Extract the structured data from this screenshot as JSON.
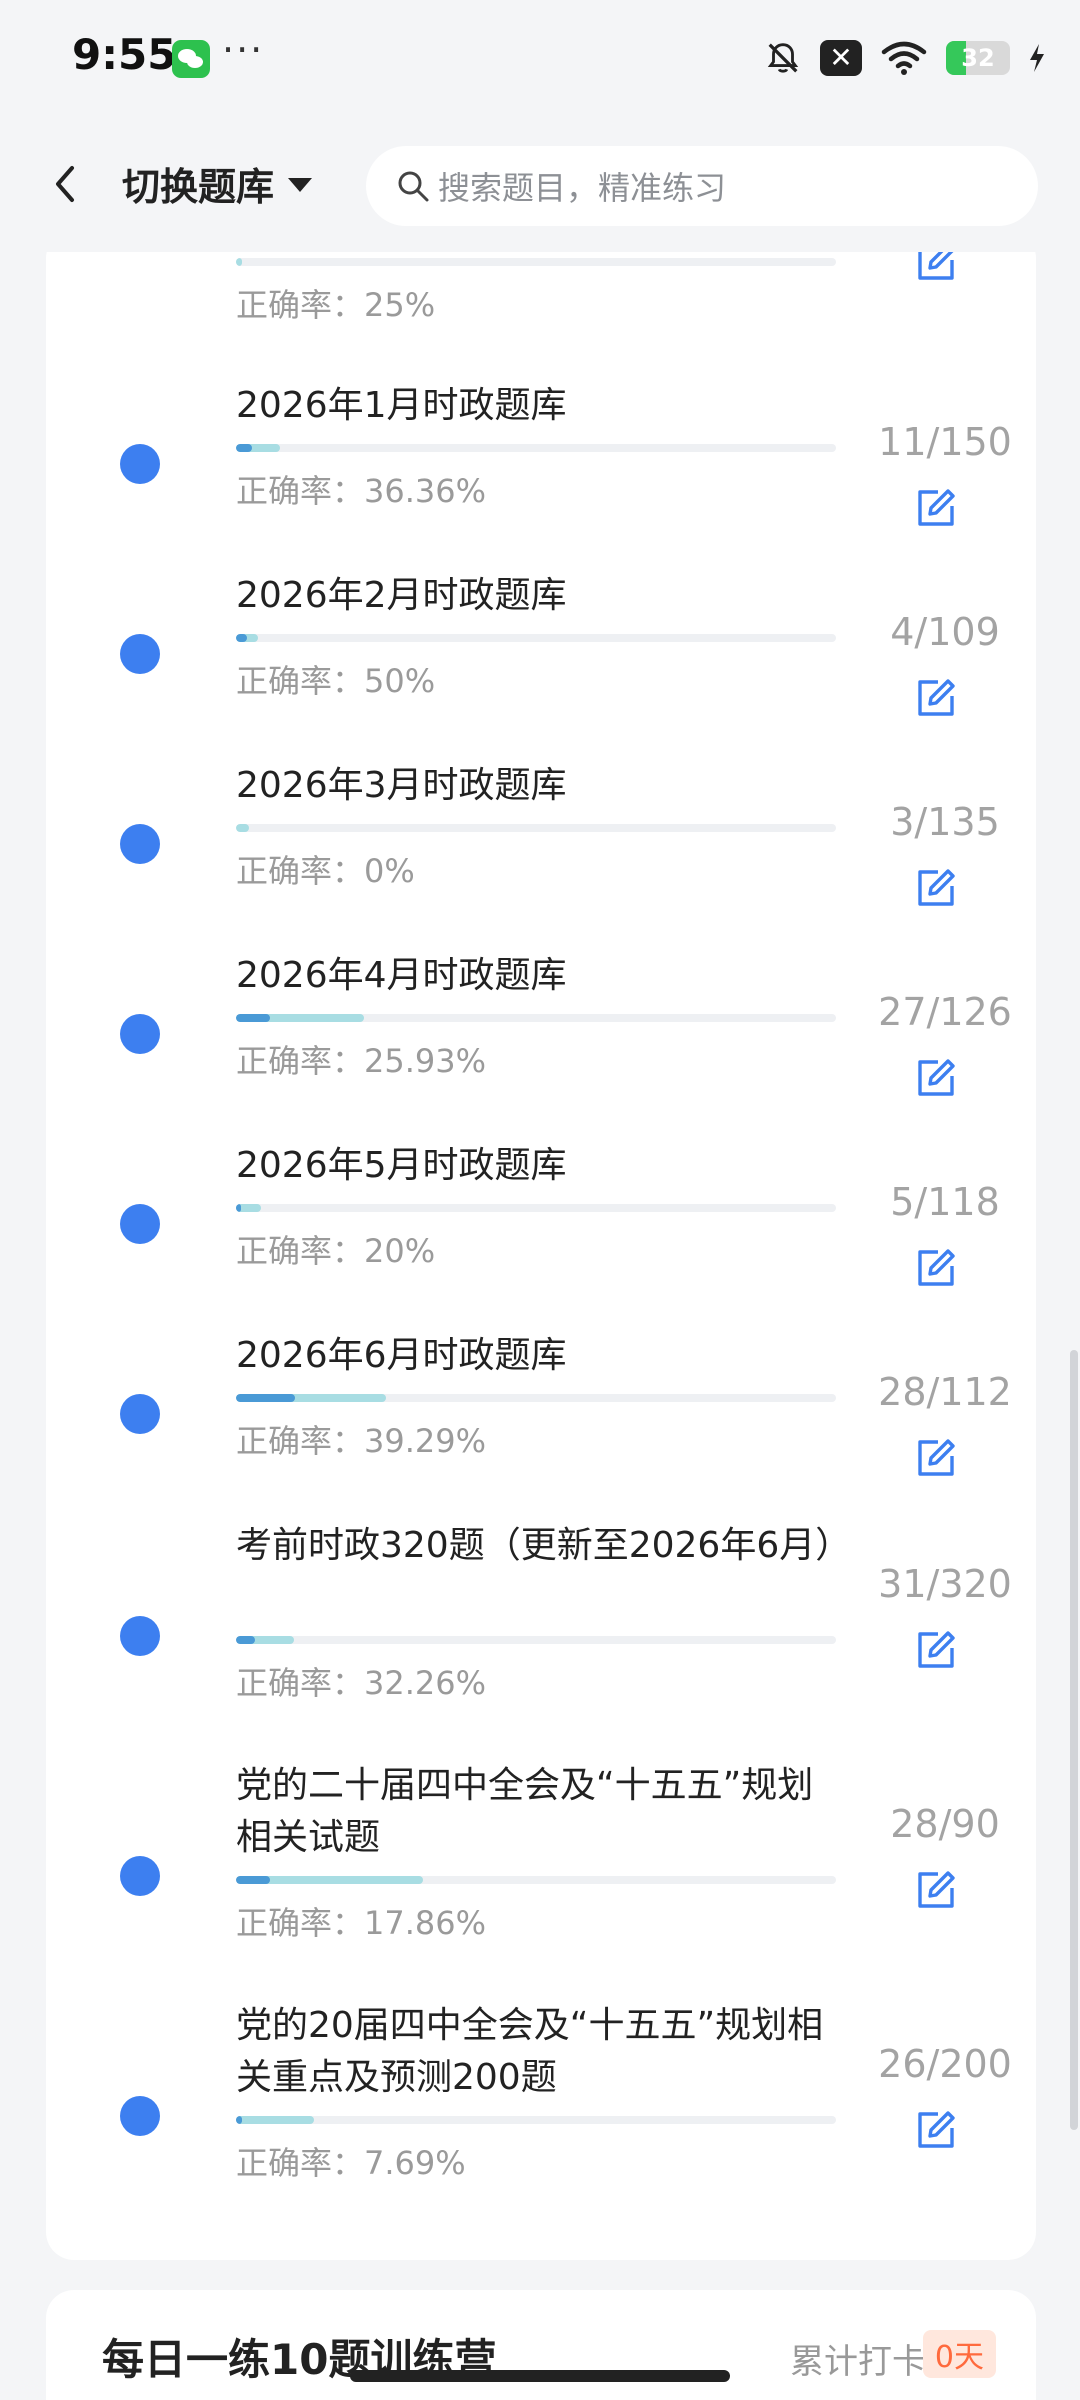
{
  "status": {
    "time": "9:55",
    "dots": "···",
    "battery": "32"
  },
  "nav": {
    "switch_label": "切换题库",
    "search_placeholder": "搜索题目，精准练习"
  },
  "partial_item": {
    "accuracy": "正确率：25%",
    "progress": 0.01
  },
  "items": [
    {
      "title": "2026年1月时政题库",
      "accuracy": "正确率：36.36%",
      "count": "11/150",
      "progress_done": 0.073,
      "progress_correct": 0.027
    },
    {
      "title": "2026年2月时政题库",
      "accuracy": "正确率：50%",
      "count": "4/109",
      "progress_done": 0.037,
      "progress_correct": 0.018
    },
    {
      "title": "2026年3月时政题库",
      "accuracy": "正确率：0%",
      "count": "3/135",
      "progress_done": 0.022,
      "progress_correct": 0.0
    },
    {
      "title": "2026年4月时政题库",
      "accuracy": "正确率：25.93%",
      "count": "27/126",
      "progress_done": 0.214,
      "progress_correct": 0.056
    },
    {
      "title": "2026年5月时政题库",
      "accuracy": "正确率：20%",
      "count": "5/118",
      "progress_done": 0.042,
      "progress_correct": 0.008
    },
    {
      "title": "2026年6月时政题库",
      "accuracy": "正确率：39.29%",
      "count": "28/112",
      "progress_done": 0.25,
      "progress_correct": 0.098
    },
    {
      "title": "考前时政320题（更新至2026年6月）",
      "accuracy": "正确率：32.26%",
      "count": "31/320",
      "progress_done": 0.097,
      "progress_correct": 0.031
    },
    {
      "title": "党的二十届四中全会及“十五五”规划相关试题",
      "accuracy": "正确率：17.86%",
      "count": "28/90",
      "progress_done": 0.311,
      "progress_correct": 0.056
    },
    {
      "title": "党的20届四中全会及“十五五”规划相关重点及预测200题",
      "accuracy": "正确率：7.69%",
      "count": "26/200",
      "progress_done": 0.13,
      "progress_correct": 0.01
    }
  ],
  "next_card": {
    "title": "每日一练10题训练营",
    "right_text": "累计打卡",
    "tag": "0天"
  },
  "colors": {
    "dot": "#3d7ff0",
    "edit_icon": "#3d7ff0",
    "progress_light": "#a8dde3",
    "progress_dark": "#4a9ad6"
  }
}
